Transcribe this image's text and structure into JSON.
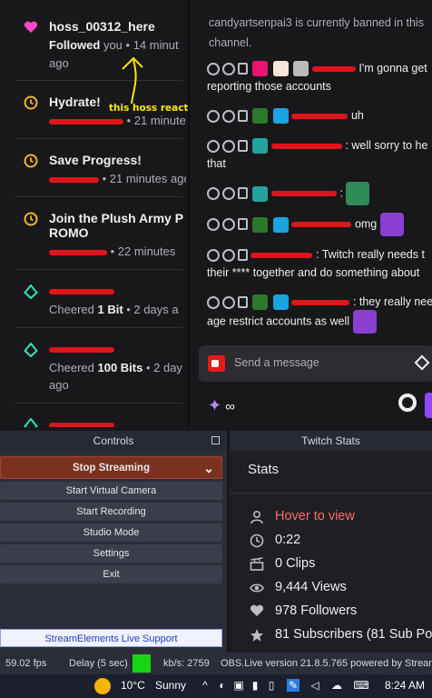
{
  "activity_feed": {
    "items": [
      {
        "title": "hoss_00312_here",
        "sub_bold": "Followed",
        "sub_rest": " you • 14 minut",
        "sub_line2": "ago",
        "icon": "heart-icon"
      },
      {
        "title": "Hydrate!",
        "sub_rest": " • 21 minutes",
        "icon": "timer-icon"
      },
      {
        "title": "Save Progress!",
        "sub_rest": " • 21 minutes ago",
        "icon": "timer-icon"
      },
      {
        "title": "Join the Plush Army P",
        "title_line2": "ROMO",
        "sub_rest": " • 22 minutes",
        "icon": "timer-icon"
      },
      {
        "sub_pre": "Cheered ",
        "sub_bold": "1 Bit",
        "sub_rest": " • 2 days a",
        "icon": "bits-icon"
      },
      {
        "sub_pre": "Cheered ",
        "sub_bold": "100 Bits",
        "sub_rest": " • 2 day",
        "sub_line2": "ago",
        "icon": "bits-icon"
      },
      {
        "icon": "bits-icon"
      }
    ]
  },
  "annotation": "this hoss reacted",
  "chat": {
    "ban_notice_line1": "candyartsenpai3 is currently banned in this",
    "ban_notice_line2": "channel.",
    "messages": [
      {
        "text": "I'm gonna get",
        "line2": "reporting those accounts"
      },
      {
        "text": " uh"
      },
      {
        "text": ": well sorry to he",
        "line2": "that"
      },
      {
        "text": ":"
      },
      {
        "text": " omg"
      },
      {
        "text": ": Twitch really needs t",
        "line2": "their **** together and do something about"
      },
      {
        "text": ": they really nee",
        "line2": "age restrict accounts as well"
      }
    ],
    "input_placeholder": "Send a message",
    "points": "∞"
  },
  "controls": {
    "title": "Controls",
    "stop_streaming": "Stop Streaming",
    "buttons": [
      "Start Virtual Camera",
      "Start Recording",
      "Studio Mode",
      "Settings",
      "Exit"
    ],
    "support": "StreamElements Live Support"
  },
  "twitch_stats": {
    "title": "Twitch Stats",
    "heading": "Stats",
    "rows": [
      {
        "icon": "user-icon",
        "text": "Hover to view",
        "hover": true
      },
      {
        "icon": "clock-icon",
        "text": "0:22"
      },
      {
        "icon": "clips-icon",
        "text": "0 Clips"
      },
      {
        "icon": "eye-icon",
        "text": "9,444 Views"
      },
      {
        "icon": "heart-icon",
        "text": "978 Followers"
      },
      {
        "icon": "star-icon",
        "text": "81 Subscribers (81 Sub Po"
      }
    ]
  },
  "statusbar": {
    "fps": "59.02 fps",
    "delay": "Delay (5 sec)",
    "kbs": "kb/s: 2759",
    "version": "OBS.Live version 21.8.5.765 powered by Stream"
  },
  "taskbar": {
    "temp": "10°C",
    "weather": "Sunny",
    "time": "8:24 AM"
  },
  "colors": {
    "accent": "#9147ff",
    "redact": "#e0151a",
    "stop": "#7a3120",
    "live_green": "#14d614"
  }
}
